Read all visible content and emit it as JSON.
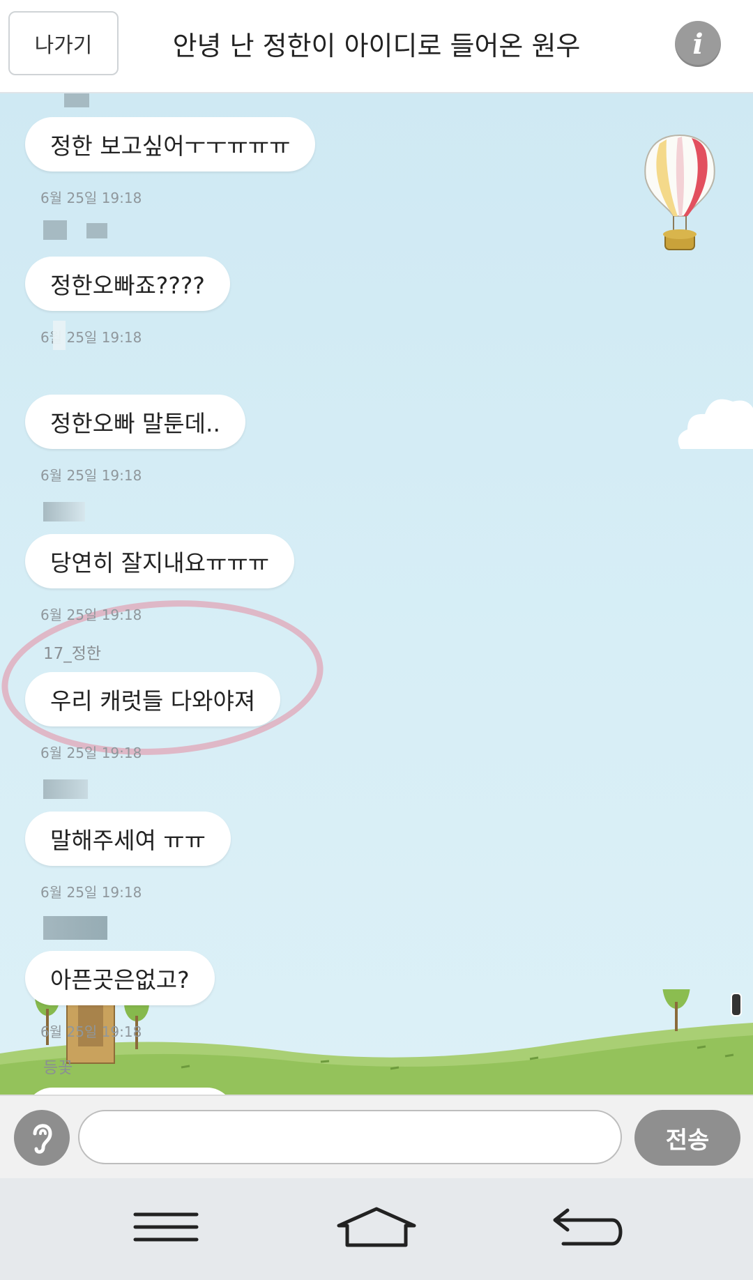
{
  "header": {
    "exit_label": "나가기",
    "title": "안녕 난 정한이 아이디로 들어온 원우",
    "info_icon": "info-icon"
  },
  "messages": [
    {
      "sender": "",
      "text": "정한 보고싶어ㅜㅜㅠㅠㅠ",
      "time": "6월 25일 19:18"
    },
    {
      "sender": "",
      "text": "정한오빠죠????",
      "time": "6월 25일 19:18"
    },
    {
      "sender": "",
      "text": "정한오빠 말툰데..",
      "time": "6월 25일 19:18"
    },
    {
      "sender": "",
      "text": "당연히 잘지내요ㅠㅠㅠ",
      "time": "6월 25일 19:18"
    },
    {
      "sender": "17_정한",
      "text": "우리 캐럿들 다와야져",
      "time": "6월 25일 19:18"
    },
    {
      "sender": "",
      "text": "말해주세여 ㅠㅠ",
      "time": "6월 25일 19:18"
    },
    {
      "sender": "",
      "text": "아픈곳은없고?",
      "time": "6월 25일 19:18"
    },
    {
      "sender": "등꽃",
      "text": "",
      "time": ""
    }
  ],
  "input": {
    "placeholder": "",
    "value": "",
    "send_label": "전송",
    "voice_icon": "ear-icon"
  },
  "nav": {
    "menu_icon": "menu-icon",
    "home_icon": "home-icon",
    "back_icon": "back-icon"
  },
  "colors": {
    "chat_bg": "#d4ecf5",
    "bubble": "#ffffff",
    "highlight": "#e68ca0",
    "button_gray": "#8f8f8f"
  }
}
